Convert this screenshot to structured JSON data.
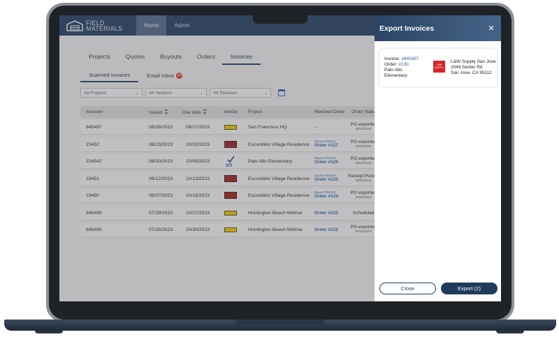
{
  "brand": {
    "logo_line1": "FIELD",
    "logo_line2": "MATERIALS"
  },
  "topnav": [
    {
      "label": "Home"
    },
    {
      "label": "Admin"
    }
  ],
  "tabs": [
    {
      "label": "Projects"
    },
    {
      "label": "Quotes"
    },
    {
      "label": "Buyouts"
    },
    {
      "label": "Orders"
    },
    {
      "label": "Invoices"
    }
  ],
  "subtabs": {
    "scanned": "Scanned Invoices",
    "email": "Email Inbox",
    "email_count": "12"
  },
  "filters": {
    "projects": "All Projects",
    "vendors": "All Vendors",
    "statuses": "All Statuses"
  },
  "table": {
    "headers": {
      "invoice": "Invoice#",
      "issued": "Issued",
      "due": "Due date",
      "vendor": "Vendor",
      "project": "Project",
      "matched": "Matched Order",
      "status": "Order Status"
    },
    "rows": [
      {
        "invoice": "845497",
        "issued": "08/28/2023",
        "due": "09/27/2023",
        "vendor": "crest-logo",
        "project": "San Francisco HQ",
        "buyout": "",
        "order": "--",
        "status": "PO exported",
        "status_date": "08/23/2023"
      },
      {
        "invoice": "23452",
        "issued": "08/23/2023",
        "due": "10/02/2023",
        "vendor": "red-logo",
        "project": "Escondido Village Residence",
        "buyout": "Buyout #00119",
        "order": "Order #127",
        "status": "PO exported",
        "status_date": "08/23/2023"
      },
      {
        "invoice": "234542",
        "issued": "08/20/2023",
        "due": "10/05/2023",
        "vendor": "sti-logo",
        "project": "Palo Alto Elementary",
        "buyout": "Buyout #00118",
        "order": "Order #126",
        "status": "PO exported",
        "status_date": "08/23/2023"
      },
      {
        "invoice": "23451",
        "issued": "08/12/2023",
        "due": "10/13/2023",
        "vendor": "red-logo",
        "project": "Escondido Village Residence",
        "buyout": "Buyout #00119",
        "order": "Order #125",
        "status": "Receipt Posted",
        "status_date": "08/23/2023"
      },
      {
        "invoice": "23450",
        "issued": "08/07/2023",
        "due": "10/18/2023",
        "vendor": "red-logo",
        "project": "Escondido Village Residence",
        "buyout": "Buyout #00119",
        "order": "Order #124",
        "status": "PO exported",
        "status_date": "08/23/2023"
      },
      {
        "invoice": "845490",
        "issued": "07/29/2023",
        "due": "10/27/2023",
        "vendor": "crest-logo",
        "project": "Huntington Beach Midrise",
        "buyout": "",
        "order": "Order #123",
        "status": "Scheduled",
        "status_date": ""
      },
      {
        "invoice": "845490",
        "issued": "07/26/2023",
        "due": "10/30/2023",
        "vendor": "crest-logo",
        "project": "Huntington Beach Midrise",
        "buyout": "",
        "order": "Order #122",
        "status": "PO exported",
        "status_date": "08/23/2023"
      }
    ]
  },
  "drawer": {
    "title": "Export Invoices",
    "close_glyph": "✕",
    "invoice_label": "Invoice:",
    "invoice_num": "#845497",
    "order_label": "Order:",
    "order_num": "#130",
    "project_line1": "Palo Alto",
    "project_line2": "Elementary",
    "vendor_name": "L&W Supply San Jose",
    "vendor_addr1": "2049 Senter Rd",
    "vendor_addr2": "San Jose, CA 95112",
    "vendor_logo_text": "L&W SUPPLY",
    "close_label": "Close",
    "export_label": "Export (2)"
  }
}
